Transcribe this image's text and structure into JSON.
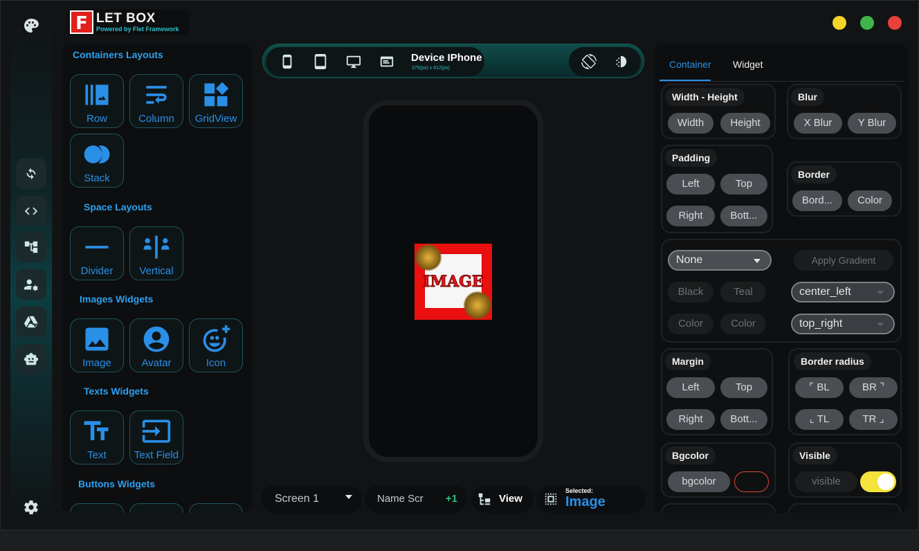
{
  "app": {
    "logo_badge": "F",
    "title": "LET BOX",
    "subtitle": "Powered by Flet Framework",
    "accent": "#2a8fe6",
    "window_dots": [
      "#f5d329",
      "#3fb54a",
      "#e8403a"
    ]
  },
  "rail": {
    "icons": [
      "palette-icon",
      "refresh-icon",
      "code-icon",
      "tree-icon",
      "people-settings-icon",
      "drive-add-icon",
      "robot-icon",
      "settings-icon"
    ]
  },
  "widgets": {
    "sections": [
      {
        "title": "Containers Layouts",
        "items": [
          {
            "label": "Row",
            "icon": "row-icon"
          },
          {
            "label": "Column",
            "icon": "column-icon"
          },
          {
            "label": "GridView",
            "icon": "gridview-icon"
          },
          {
            "label": "Stack",
            "icon": "stack-icon"
          }
        ]
      },
      {
        "title": "Space Layouts",
        "items": [
          {
            "label": "Divider",
            "icon": "divider-icon"
          },
          {
            "label": "Vertical",
            "icon": "vertical-divider-icon"
          }
        ]
      },
      {
        "title": "Images Widgets",
        "items": [
          {
            "label": "Image",
            "icon": "image-icon"
          },
          {
            "label": "Avatar",
            "icon": "avatar-icon"
          },
          {
            "label": "Icon",
            "icon": "emoji-add-icon"
          }
        ]
      },
      {
        "title": "Texts Widgets",
        "items": [
          {
            "label": "Text",
            "icon": "text-icon"
          },
          {
            "label": "Text Field",
            "icon": "text-field-icon"
          }
        ]
      },
      {
        "title": "Buttons Widgets",
        "items": []
      }
    ]
  },
  "device_bar": {
    "name": "Device IPhone",
    "size": "375(px) x 812(px)"
  },
  "canvas": {
    "image_text": "IMAGE"
  },
  "bottom": {
    "screen": "Screen 1",
    "name_placeholder": "Name Scr",
    "add": "+1",
    "view": "View",
    "selected_label": "Selected:",
    "selected_value": "Image"
  },
  "props": {
    "tabs": [
      "Container",
      "Widget"
    ],
    "width_height": {
      "title": "Width - Height",
      "width": "Width",
      "height": "Height"
    },
    "blur": {
      "title": "Blur",
      "x": "X Blur",
      "y": "Y Blur"
    },
    "padding": {
      "title": "Padding",
      "left": "Left",
      "top": "Top",
      "right": "Right",
      "bottom": "Bott..."
    },
    "border": {
      "title": "Border",
      "border": "Bord...",
      "color": "Color"
    },
    "gradient": {
      "type": "None",
      "apply": "Apply Gradient",
      "color1": "Black",
      "color2": "Teal",
      "begin": "center_left",
      "c1": "Color",
      "c2": "Color",
      "end": "top_right"
    },
    "margin": {
      "title": "Margin",
      "left": "Left",
      "top": "Top",
      "right": "Right",
      "bottom": "Bott..."
    },
    "border_radius": {
      "title": "Border radius",
      "bl": "⌜ BL",
      "br": "BR ⌝",
      "tl": "⌞ TL",
      "tr": "TR ⌟"
    },
    "bgcolor": {
      "title": "Bgcolor",
      "label": "bgcolor"
    },
    "visible": {
      "title": "Visible",
      "label": "visible",
      "on": true
    }
  }
}
